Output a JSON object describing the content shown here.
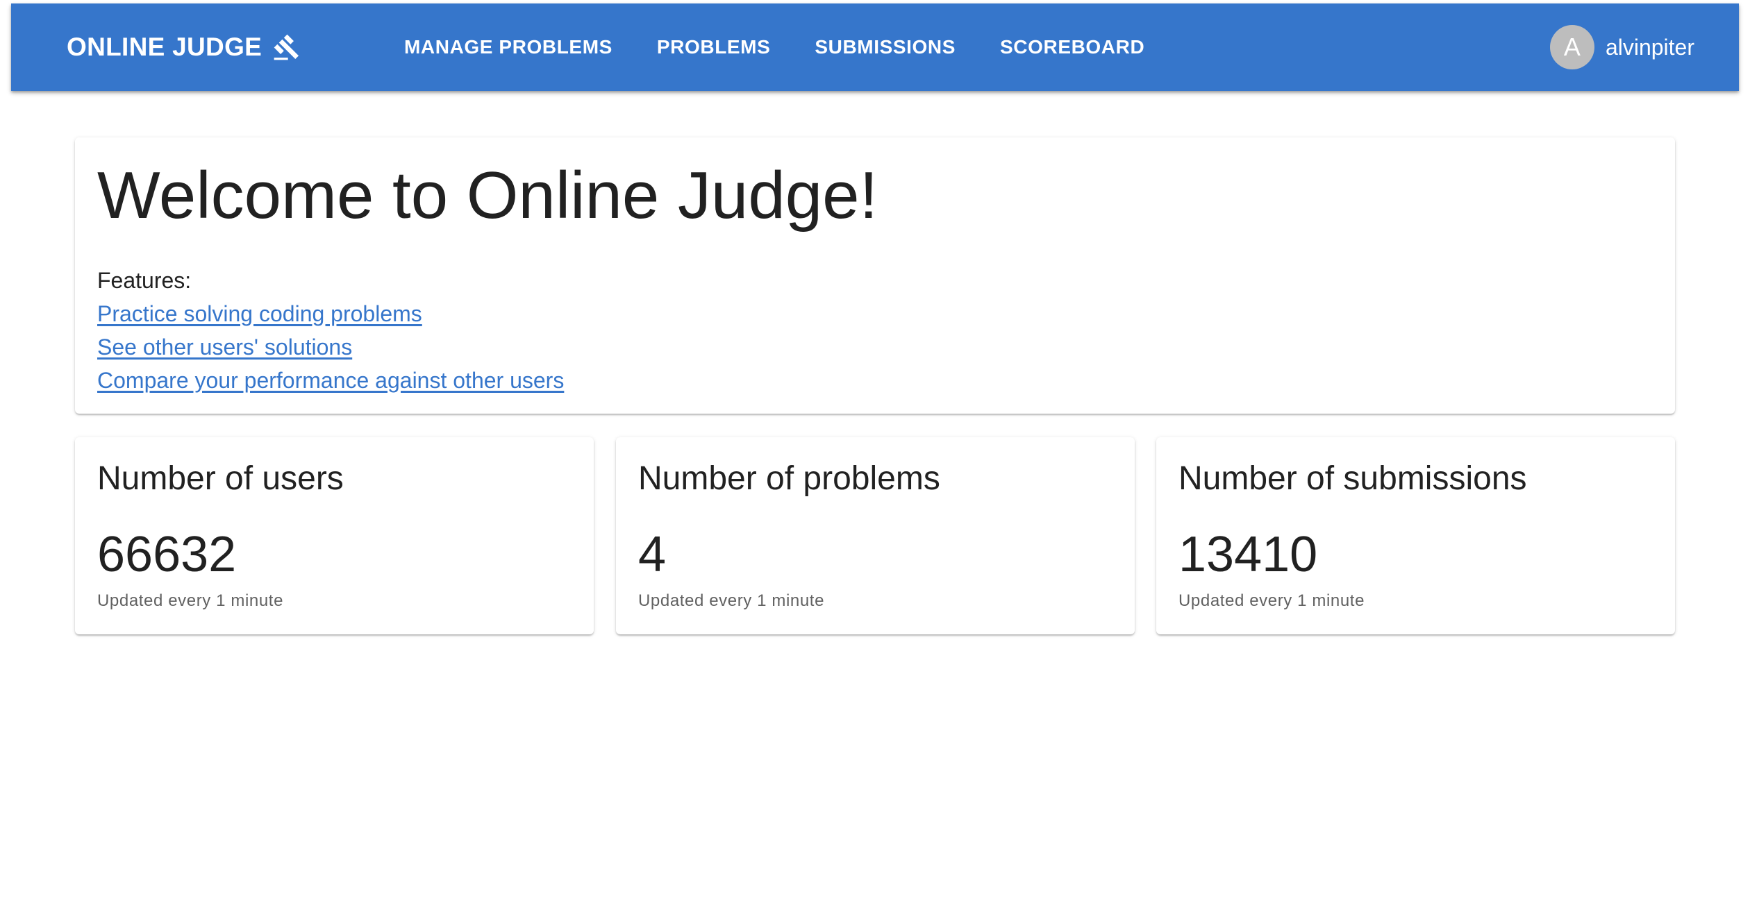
{
  "colors": {
    "primary": "#3676cb",
    "appbar_text": "#ffffff",
    "avatar_bg": "#bdbdbd",
    "link": "#3676cb"
  },
  "appbar": {
    "brand": "ONLINE JUDGE",
    "brand_icon": "gavel-icon",
    "nav": [
      {
        "label": "MANAGE PROBLEMS"
      },
      {
        "label": "PROBLEMS"
      },
      {
        "label": "SUBMISSIONS"
      },
      {
        "label": "SCOREBOARD"
      }
    ],
    "user": {
      "avatar_letter": "A",
      "name": "alvinpiter"
    }
  },
  "welcome": {
    "title": "Welcome to Online Judge!",
    "features_label": "Features:",
    "features": [
      {
        "label": "Practice solving coding problems"
      },
      {
        "label": "See other users' solutions"
      },
      {
        "label": "Compare your performance against other users"
      }
    ]
  },
  "stats": [
    {
      "title": "Number of users",
      "value": "66632",
      "note": "Updated every 1 minute"
    },
    {
      "title": "Number of problems",
      "value": "4",
      "note": "Updated every 1 minute"
    },
    {
      "title": "Number of submissions",
      "value": "13410",
      "note": "Updated every 1 minute"
    }
  ]
}
